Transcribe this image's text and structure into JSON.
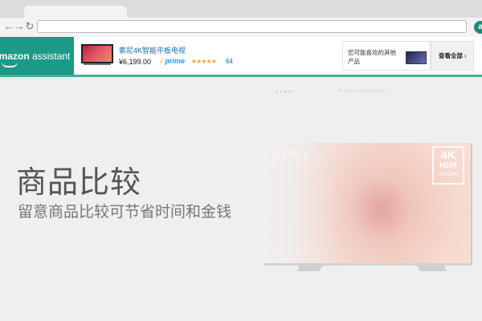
{
  "browser": {
    "back_glyph": "←",
    "forward_glyph": "→",
    "reload_glyph": "↻",
    "url": "",
    "extension_letter": "a"
  },
  "assistant": {
    "brand_bold": "amazon",
    "brand_rest": "assistant",
    "product": {
      "title": "索尼4K智能平板电视",
      "price": "¥6,199.00",
      "prime_check": "✓",
      "prime_label": "prime",
      "stars": "★★★★★",
      "rating": 4.5,
      "review_count": "64"
    },
    "recommendation_text": "您可能喜欢的其他产品",
    "see_all_label": "查看全部",
    "see_all_chevron": "›"
  },
  "main": {
    "faint_text_1": "★★★★☆",
    "faint_text_2": "45 Answered Questions",
    "tv_brand": "SONY",
    "badge_4k": "4K",
    "badge_hdr": "HDR",
    "badge_ultra": "ULTRA HD",
    "heading": "商品比较",
    "subheading": "留意商品比较可节省时间和金钱"
  },
  "colors": {
    "brand_teal": "#1c9a88",
    "link_blue": "#0d6fb8",
    "star_orange": "#f1a33a",
    "prime_blue": "#1a98ff"
  }
}
